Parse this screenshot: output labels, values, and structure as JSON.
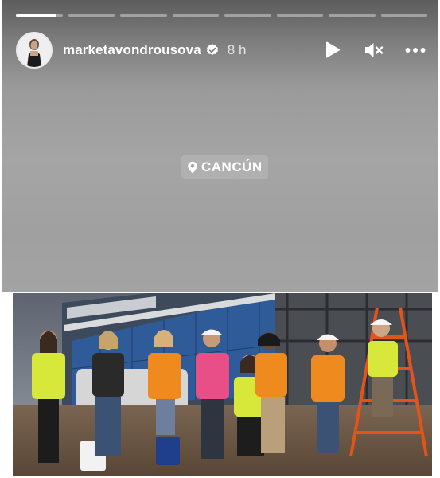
{
  "story": {
    "progress_segments": 8,
    "progress_active_fraction": 0.85,
    "username": "marketavondrousova",
    "verified": true,
    "timestamp": "8 h",
    "controls": {
      "play_icon": "play-icon",
      "mute_icon": "muted-speaker-icon",
      "more_icon": "more-horizontal-icon"
    },
    "location_sticker": "CANCÚN",
    "location_icon": "location-pin-icon"
  },
  "colors": {
    "header_bg": "#5c5c5c",
    "story_bg": "#a3a3a3",
    "verified_badge": "#ffffff",
    "vest_yellow": "#d7e83a",
    "vest_orange": "#ef8a1e",
    "vest_pink": "#e74f86"
  }
}
